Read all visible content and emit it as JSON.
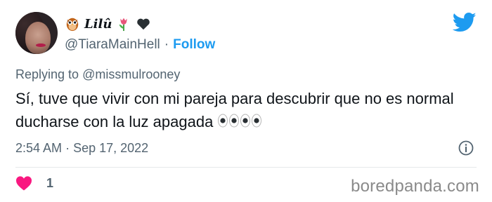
{
  "user": {
    "display_name": "Lilû",
    "handle": "@TiaraMainHell",
    "separator": "·",
    "follow_label": "Follow"
  },
  "reply": {
    "prefix": "Replying to",
    "mention": "@missmulrooney"
  },
  "tweet": {
    "text": "Sí, tuve que vivir con mi pareja para descubrir que no es normal ducharse con la luz apagada",
    "emoji": "eyes"
  },
  "meta": {
    "time": "2:54 AM",
    "separator": "·",
    "date": "Sep 17, 2022"
  },
  "engagement": {
    "likes": "1"
  },
  "watermark": "boredpanda.com",
  "colors": {
    "twitter_blue": "#1d9bf0",
    "heart_pink": "#f91880",
    "muted_text": "#536471"
  },
  "icons": [
    "owl-emoji",
    "tulip-emoji",
    "black-heart-emoji",
    "twitter-bird-icon",
    "info-icon",
    "heart-icon",
    "eyes-emoji"
  ]
}
